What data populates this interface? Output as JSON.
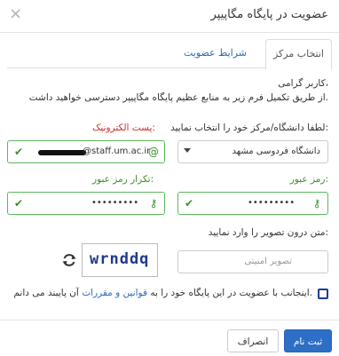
{
  "modal": {
    "title": "عضویت در پایگاه مگاپیپر",
    "close_icon": "×"
  },
  "tabs": [
    {
      "label": "انتخاب مرکز",
      "active": true
    },
    {
      "label": "شرایط عضویت",
      "active": false
    }
  ],
  "intro": {
    "greeting": "کاربر گرامی،",
    "text": "از طریق تکمیل فرم زیر به منابع عظیم پایگاه مگاپیپر دسترسی خواهید داشت."
  },
  "form": {
    "center_label": "لطفا دانشگاه/مرکز خود را انتخاب نمایید:",
    "center_value": "دانشگاه فردوسی مشهد",
    "email_label": "پست الکترونیک:",
    "email_value": "@staff.um.ac.ir",
    "password_label": "رمز عبور:",
    "password_value": "•••••••••",
    "password_confirm_label": "تکرار رمز عبور:",
    "password_confirm_value": "•••••••••",
    "captcha_label": "متن درون تصویر را وارد نمایید:",
    "captcha_placeholder": "تصویر امنیتی",
    "captcha_image_text": "wrnddq",
    "agree_prefix": "اینجانب با عضویت در این پایگاه خود را به",
    "agree_link": "قوانین و مقررات",
    "agree_suffix": "آن پایبند می دانم."
  },
  "footer": {
    "submit_label": "ثبت نام",
    "cancel_label": "انصراف"
  },
  "colors": {
    "primary": "#2d6ec7",
    "success": "#5cb85c",
    "error": "#c9302c",
    "link": "#2a6ab3"
  }
}
